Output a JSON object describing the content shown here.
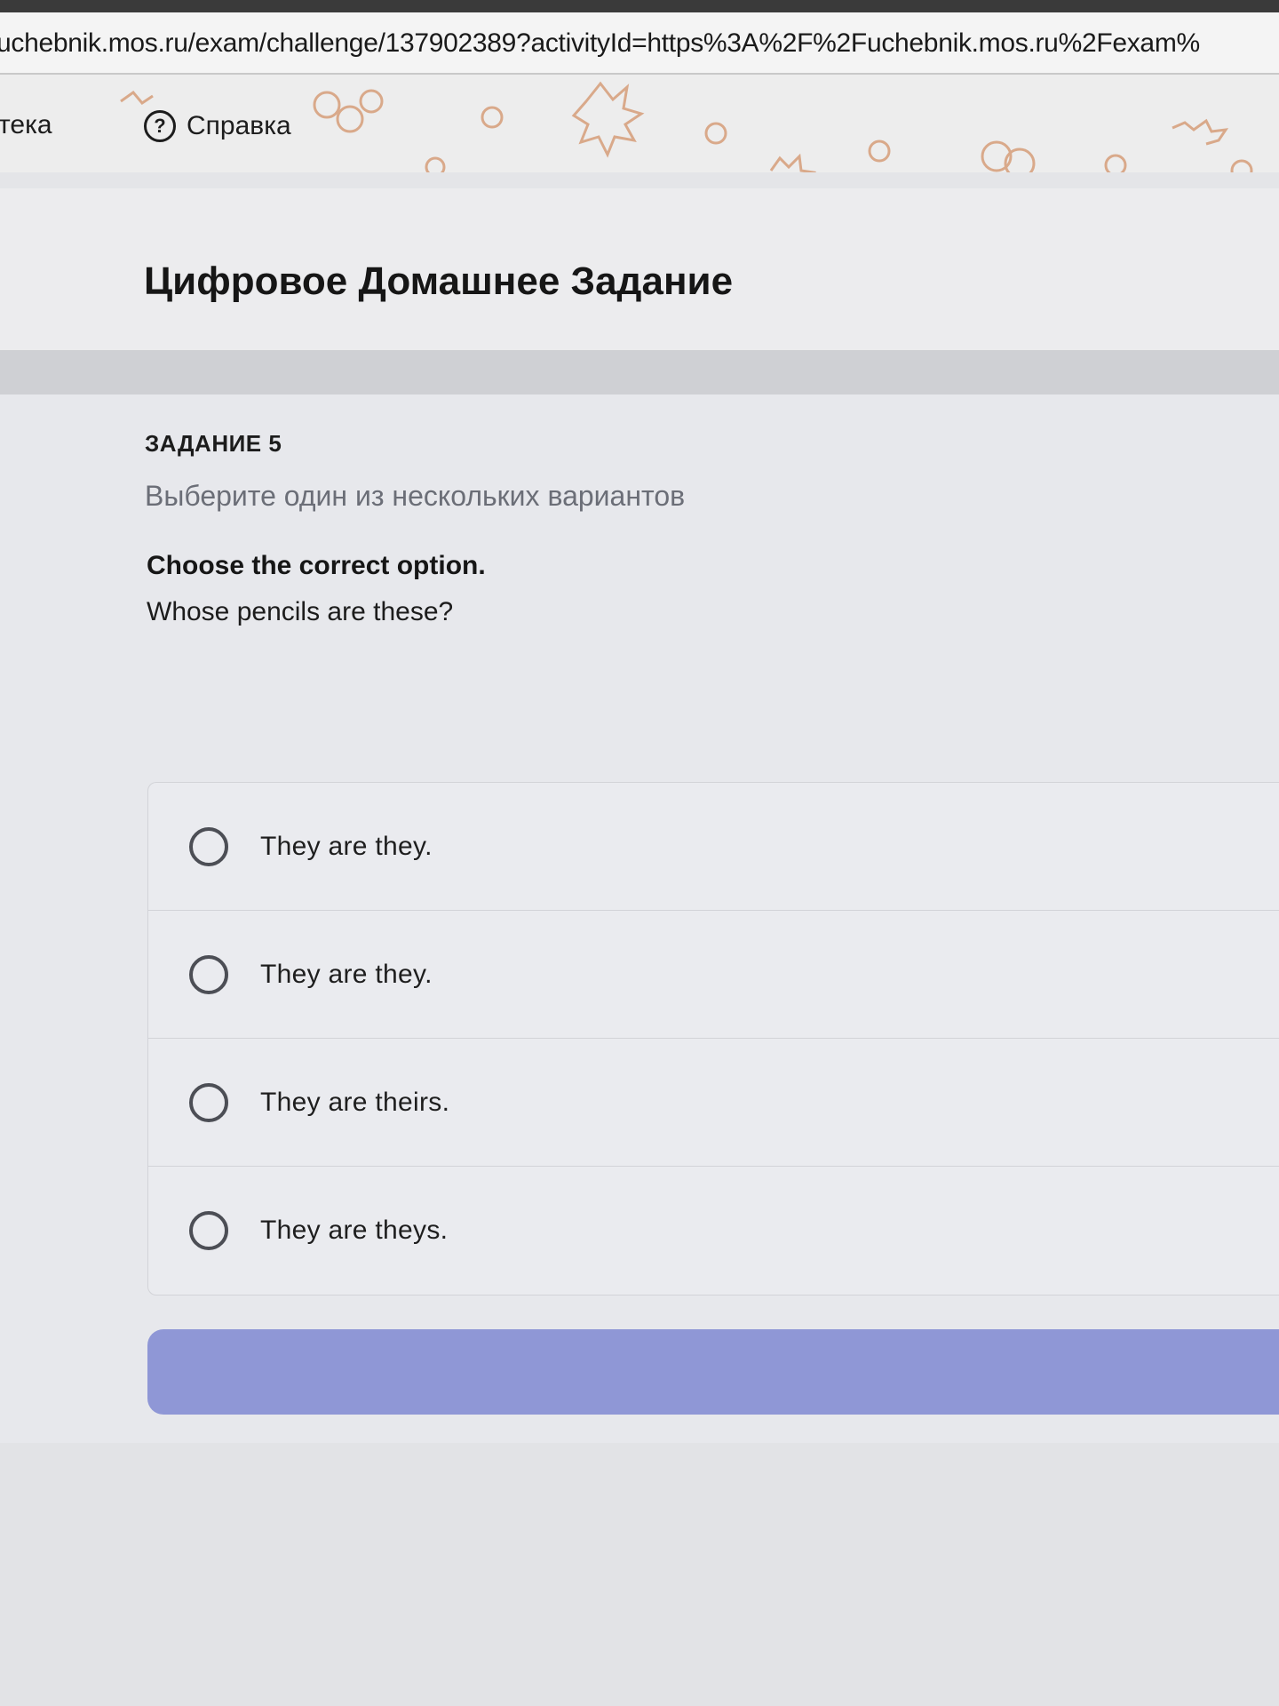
{
  "browser": {
    "url": "uchebnik.mos.ru/exam/challenge/137902389?activityId=https%3A%2F%2Fuchebnik.mos.ru%2Fexam%",
    "bookmarks": {
      "left_partial_label": "тека",
      "help_label": "Справка",
      "help_icon_glyph": "?"
    }
  },
  "header": {
    "title": "Цифровое Домашнее Задание"
  },
  "task": {
    "label": "ЗАДАНИЕ 5",
    "instruction": "Выберите один из нескольких вариантов",
    "question_title": "Choose the correct option.",
    "question_text": "Whose pencils are these?",
    "options": [
      {
        "label": "They are they."
      },
      {
        "label": "They are they."
      },
      {
        "label": "They are theirs."
      },
      {
        "label": "They are theys."
      }
    ]
  },
  "colors": {
    "accent_button": "#8f97d6",
    "bookmark_decor": "#d9a98a"
  }
}
